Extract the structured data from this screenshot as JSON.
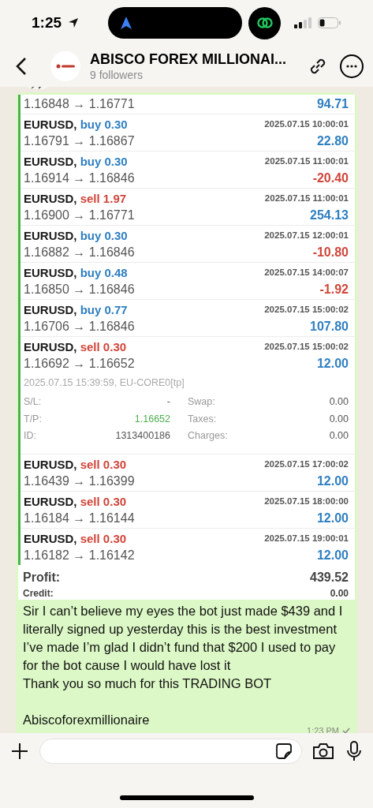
{
  "status_bar": {
    "time": "1:25"
  },
  "header": {
    "title": "ABISCO FOREX MILLIONAI...",
    "subtitle": "9 followers"
  },
  "trades": [
    {
      "kind": "partial",
      "prices": "1.16848 → 1.16771",
      "profit": "94.71",
      "loss": false
    },
    {
      "kind": "buy",
      "symbol": "EURUSD,",
      "order": "buy 0.30",
      "time": "2025.07.15 10:00:01",
      "prices": "1.16791 → 1.16867",
      "profit": "22.80",
      "loss": false
    },
    {
      "kind": "buy",
      "symbol": "EURUSD,",
      "order": "buy 0.30",
      "time": "2025.07.15 11:00:01",
      "prices": "1.16914 → 1.16846",
      "profit": "-20.40",
      "loss": true
    },
    {
      "kind": "sell",
      "symbol": "EURUSD,",
      "order": "sell 1.97",
      "time": "2025.07.15 11:00:01",
      "prices": "1.16900 → 1.16771",
      "profit": "254.13",
      "loss": false
    },
    {
      "kind": "buy",
      "symbol": "EURUSD,",
      "order": "buy 0.30",
      "time": "2025.07.15 12:00:01",
      "prices": "1.16882 → 1.16846",
      "profit": "-10.80",
      "loss": true
    },
    {
      "kind": "buy",
      "symbol": "EURUSD,",
      "order": "buy 0.48",
      "time": "2025.07.15 14:00:07",
      "prices": "1.16850 → 1.16846",
      "profit": "-1.92",
      "loss": true
    },
    {
      "kind": "buy",
      "symbol": "EURUSD,",
      "order": "buy 0.77",
      "time": "2025.07.15 15:00:02",
      "prices": "1.16706 → 1.16846",
      "profit": "107.80",
      "loss": false
    },
    {
      "kind": "sell",
      "symbol": "EURUSD,",
      "order": "sell 0.30",
      "time": "2025.07.15 15:00:02",
      "prices": "1.16692 → 1.16652",
      "profit": "12.00",
      "loss": false,
      "details": {
        "closed": "2025.07.15 15:39:59, EU-CORE0[tp]",
        "fields": [
          {
            "label": "S/L:",
            "value": "-",
            "highlight": false
          },
          {
            "label": "Swap:",
            "value": "0.00",
            "highlight": false
          },
          {
            "label": "T/P:",
            "value": "1.16652",
            "highlight": true
          },
          {
            "label": "Taxes:",
            "value": "0.00",
            "highlight": false
          },
          {
            "label": "ID:",
            "value": "1313400186",
            "highlight": false
          },
          {
            "label": "Charges:",
            "value": "0.00",
            "highlight": false
          }
        ]
      }
    },
    {
      "kind": "sell",
      "symbol": "EURUSD,",
      "order": "sell 0.30",
      "time": "2025.07.15 17:00:02",
      "prices": "1.16439 → 1.16399",
      "profit": "12.00",
      "loss": false
    },
    {
      "kind": "sell",
      "symbol": "EURUSD,",
      "order": "sell 0.30",
      "time": "2025.07.15 18:00:00",
      "prices": "1.16184 → 1.16144",
      "profit": "12.00",
      "loss": false
    },
    {
      "kind": "sell",
      "symbol": "EURUSD,",
      "order": "sell 0.30",
      "time": "2025.07.15 19:00:01",
      "prices": "1.16182 → 1.16142",
      "profit": "12.00",
      "loss": false
    }
  ],
  "summary": [
    {
      "label": "Profit:",
      "value": "439.52"
    },
    {
      "label": "Credit:",
      "value": "0.00"
    }
  ],
  "message": {
    "paragraphs": [
      "Sir I can’t believe my eyes  the bot just made $439 and I literally signed up yesterday this is the best investment I’ve made I’m glad I didn’t fund that $200 I used to pay for the bot cause I would have lost it",
      "Thank you so much for this TRADING BOT"
    ],
    "signature": "Abiscoforexmillionaire",
    "time": "1:23 PM"
  }
}
